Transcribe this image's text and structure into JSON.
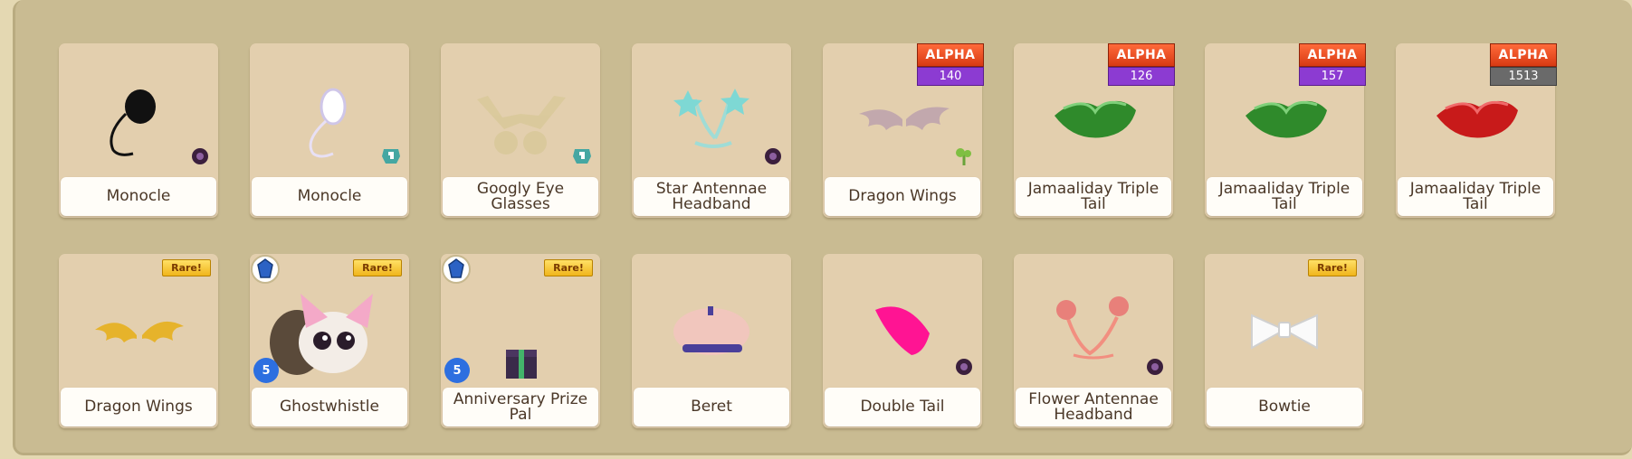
{
  "items": [
    {
      "name": "Monocle",
      "icon": "monocle-black",
      "corner": "flower-icon"
    },
    {
      "name": "Monocle",
      "icon": "monocle-white",
      "corner": "diamond-shop-icon"
    },
    {
      "name": "Googly Eye Glasses",
      "icon": "googly-eye-glasses",
      "corner": "diamond-shop-icon"
    },
    {
      "name": "Star Antennae Headband",
      "icon": "star-antennae",
      "corner": "flower-icon"
    },
    {
      "name": "Dragon Wings",
      "icon": "dragon-wings-pink",
      "corner": "seedling-icon",
      "badge": {
        "label": "ALPHA",
        "number": "140",
        "color": "#8c3bd2"
      }
    },
    {
      "name": "Jamaaliday Triple Tail",
      "icon": "triple-tail-green",
      "badge": {
        "label": "ALPHA",
        "number": "126",
        "color": "#8c3bd2"
      }
    },
    {
      "name": "Jamaaliday Triple Tail",
      "icon": "triple-tail-green",
      "badge": {
        "label": "ALPHA",
        "number": "157",
        "color": "#8c3bd2"
      }
    },
    {
      "name": "Jamaaliday Triple Tail",
      "icon": "triple-tail-red",
      "badge": {
        "label": "ALPHA",
        "number": "1513",
        "color": "#6a6a6a"
      }
    },
    {
      "name": "Dragon Wings",
      "icon": "dragon-wings-gold",
      "rare": "Rare!"
    },
    {
      "name": "Ghostwhistle",
      "icon": "ghostwhistle-pet",
      "rare": "Rare!",
      "gem": "sapphire-icon",
      "level": "5"
    },
    {
      "name": "Anniversary Prize Pal",
      "icon": "gift-box",
      "rare": "Rare!",
      "gem": "sapphire-icon",
      "level": "5"
    },
    {
      "name": "Beret",
      "icon": "beret"
    },
    {
      "name": "Double Tail",
      "icon": "double-tail-pink",
      "corner": "flower-icon"
    },
    {
      "name": "Flower Antennae Headband",
      "icon": "flower-antennae",
      "corner": "flower-icon"
    },
    {
      "name": "Bowtie",
      "icon": "bowtie-white",
      "rare": "Rare!"
    }
  ]
}
